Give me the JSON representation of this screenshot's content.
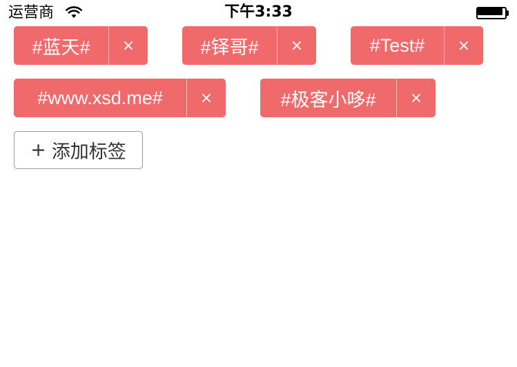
{
  "status_bar": {
    "carrier": "运营商",
    "wifi_icon": "wifi-icon",
    "time": "下午3:33",
    "battery_icon": "battery-icon"
  },
  "tags": [
    {
      "label": "#蓝天#",
      "close": "×"
    },
    {
      "label": "#铎哥#",
      "close": "×"
    },
    {
      "label": "#Test#",
      "close": "×"
    },
    {
      "label": "#www.xsd.me#",
      "close": "×"
    },
    {
      "label": "#极客小哆#",
      "close": "×"
    }
  ],
  "add_tag": {
    "plus": "+",
    "label": "添加标签"
  },
  "colors": {
    "tag_background": "#f06a6b",
    "tag_text": "#ffffff",
    "add_border": "#9a9a9a"
  }
}
